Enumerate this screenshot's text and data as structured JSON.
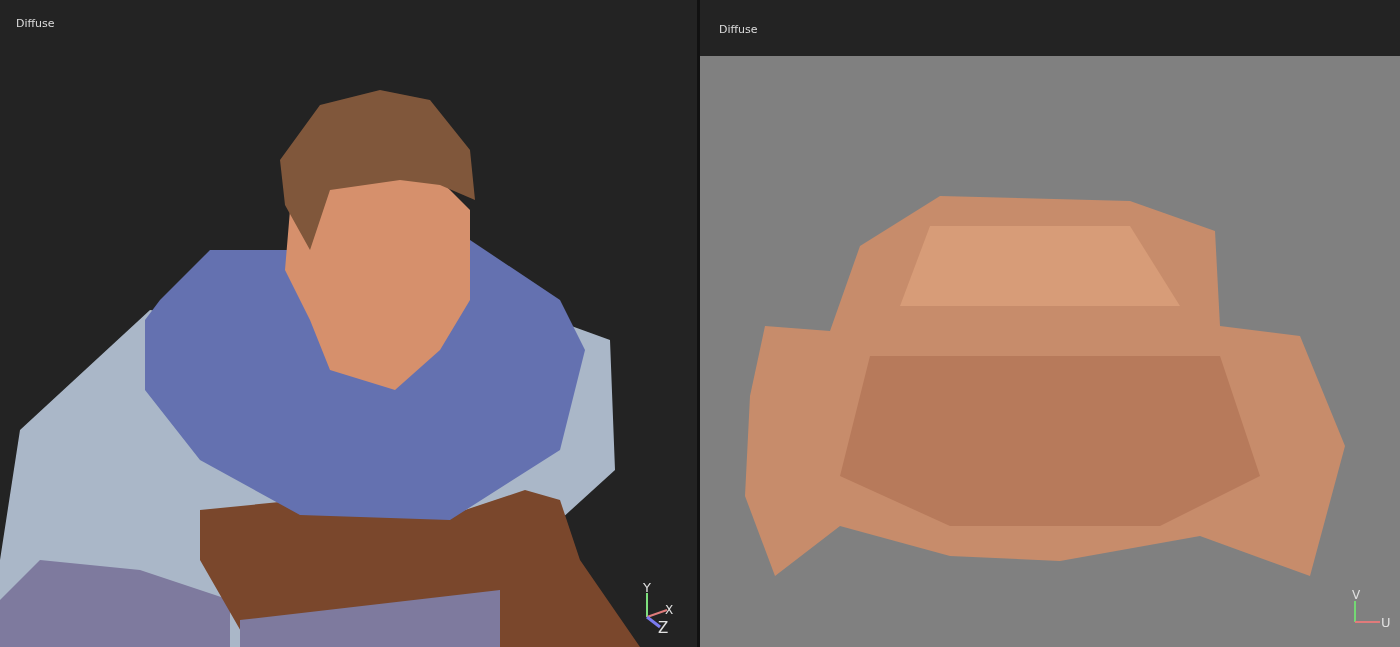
{
  "viewports": [
    {
      "kind": "model",
      "title": "Diffuse",
      "axes": [
        "Y",
        "X",
        "Z"
      ]
    },
    {
      "kind": "uv",
      "title": "Diffuse",
      "axes": [
        "V",
        "U"
      ]
    }
  ]
}
